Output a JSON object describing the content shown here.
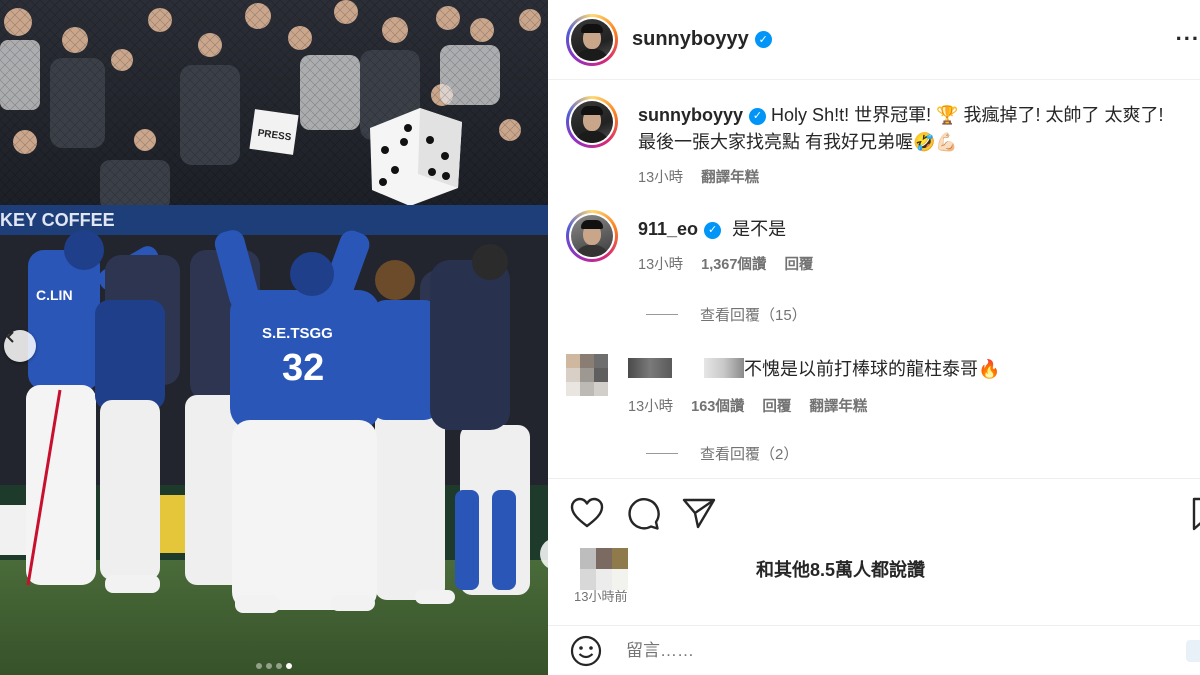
{
  "post": {
    "author": "sunnyboyyy",
    "verified_mark": "✓",
    "more_label": "...",
    "more_icon": "more-horizontal-icon"
  },
  "photo": {
    "description_icon": "baseball-celebration-photo",
    "jersey_name": "S.E.TSGG",
    "jersey_number": "32",
    "press_sign": "PRESS",
    "banner_text": "KEY COFFEE",
    "slide_count": 4,
    "active_slide": 4
  },
  "caption": {
    "username": "sunnyboyyy",
    "line1": "Holy Sh!t! 世界冠軍! 🏆 我瘋掉了! 太帥了 太爽了!",
    "line2": "最後一張大家找亮點 有我好兄弟喔🤣💪🏻",
    "time": "13小時",
    "translate": "翻譯年糕"
  },
  "comments": [
    {
      "username": "911_eo",
      "text": "是不是",
      "time": "13小時",
      "likes": "1,367個讚",
      "reply": "回覆",
      "view_replies": "查看回覆（15）"
    },
    {
      "username": "",
      "text": "不愧是以前打棒球的龍柱泰哥🔥",
      "time": "13小時",
      "likes": "163個讚",
      "reply": "回覆",
      "translate": "翻譯年糕",
      "view_replies": "查看回覆（2）"
    }
  ],
  "actions": {
    "like_icon": "heart-icon",
    "comment_icon": "comment-icon",
    "share_icon": "send-icon",
    "save_icon": "bookmark-icon"
  },
  "likes_summary": {
    "text": "和其他8.5萬人都說讚"
  },
  "post_time": "13小時前",
  "comment_box": {
    "placeholder": "留言……",
    "emoji_icon": "emoji-icon"
  },
  "colors": {
    "verified": "#0095f6",
    "jersey_blue": "#2a56b8",
    "text_primary": "#262626",
    "text_secondary": "#737373"
  }
}
